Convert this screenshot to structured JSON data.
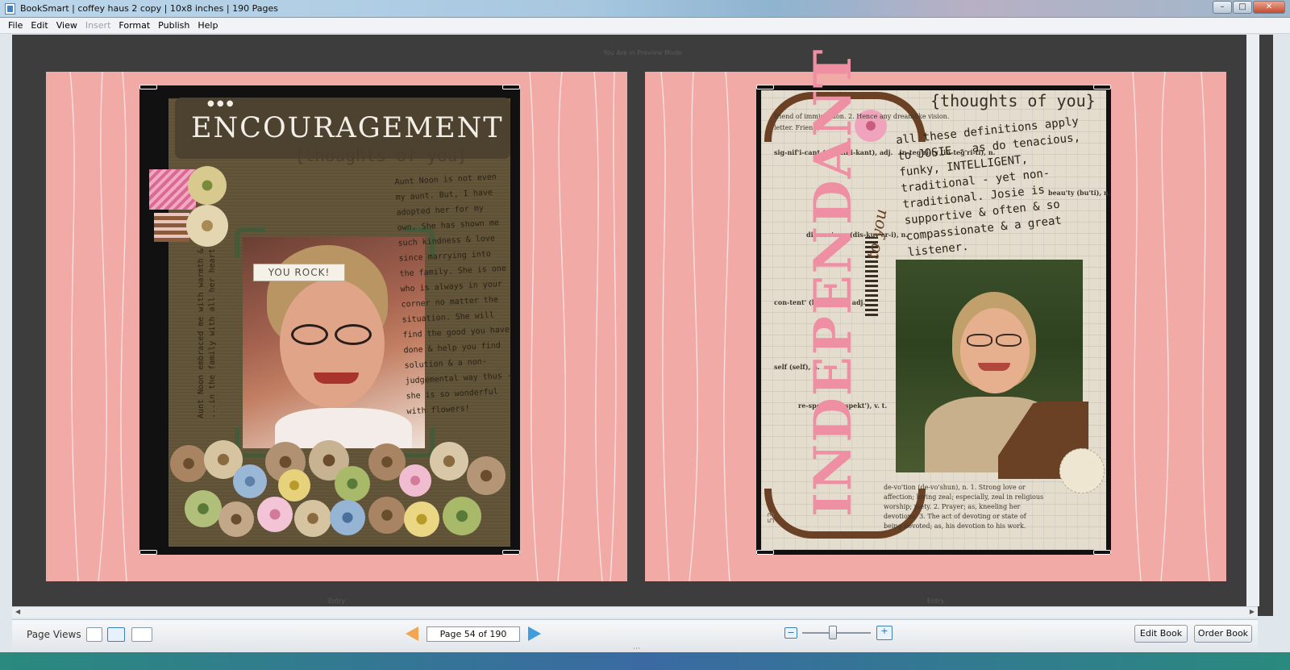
{
  "window": {
    "title": "BookSmart  |  coffey haus 2 copy  |  10x8 inches  |  190 Pages",
    "controls": {
      "minimize": "–",
      "maximize": "□",
      "close": "✕"
    }
  },
  "menu": [
    "File",
    "Edit",
    "View",
    "Insert",
    "Format",
    "Publish",
    "Help"
  ],
  "workspace": {
    "preview_notice": "You Are in Preview Mode",
    "left_page_label": "Entry",
    "right_page_label": "Entry",
    "background_color": "#3d3d3d",
    "page_color": "#f2aaa6"
  },
  "left_spread": {
    "title": "ENCOURAGEMENT",
    "subtitle": "{thoughts of you}",
    "journal": "Aunt Noon is not even my aunt. But, I have adopted her for my own. She has shown me such kindness & love since marrying into the family. She is one who is always in your corner no matter the situation. She will find the good you have done & help you find solution & a non-judgemental way thus - she is so wonderful with flowers!",
    "side_text": "Aunt Noon embraced me with warmth & ...in the family with all her heart"
  },
  "right_spread": {
    "title": "{thoughts of you}",
    "journal": "all these definitions apply to JOSIE - as do tenacious, funky, INTELLIGENT, traditional - yet non-traditional. Josie is supportive & often & so compassionate & a great listener.",
    "vertical_word": "INDEPENDANT",
    "vertical_script": "to you",
    "badge": "YOU ROCK!",
    "page_number": "53",
    "dict_lines": [
      "friend of immigration. 2. Hence any dreamlike vision.",
      "letter. Friend)",
      "sig-nif'i-cant (sig-nif'i-kant), adj.   in-teg'ri-ty (in-teg'ri-ti), n.",
      "dis-cov'er-y (dis-kuv'er-i), n.",
      "con-tent' (kon-tent'), adj.",
      "self (self), n.",
      "re-spect' (re-spekt'), v. t.",
      "de-vo'tion (de-vo'shun), n. 1. Strong love or affection; loving zeal; especially, zeal in religious worship; piety. 2. Prayer; as, kneeling her devotions. 3. The act of devoting or state of being devoted; as, his devotion to his work.",
      "beau'ty (bu'ti), n."
    ]
  },
  "toolbar": {
    "page_views_label": "Page Views",
    "page_indicator": "Page 54 of 190",
    "edit_book": "Edit Book",
    "order_book": "Order Book",
    "zoom_level": 0.45
  }
}
